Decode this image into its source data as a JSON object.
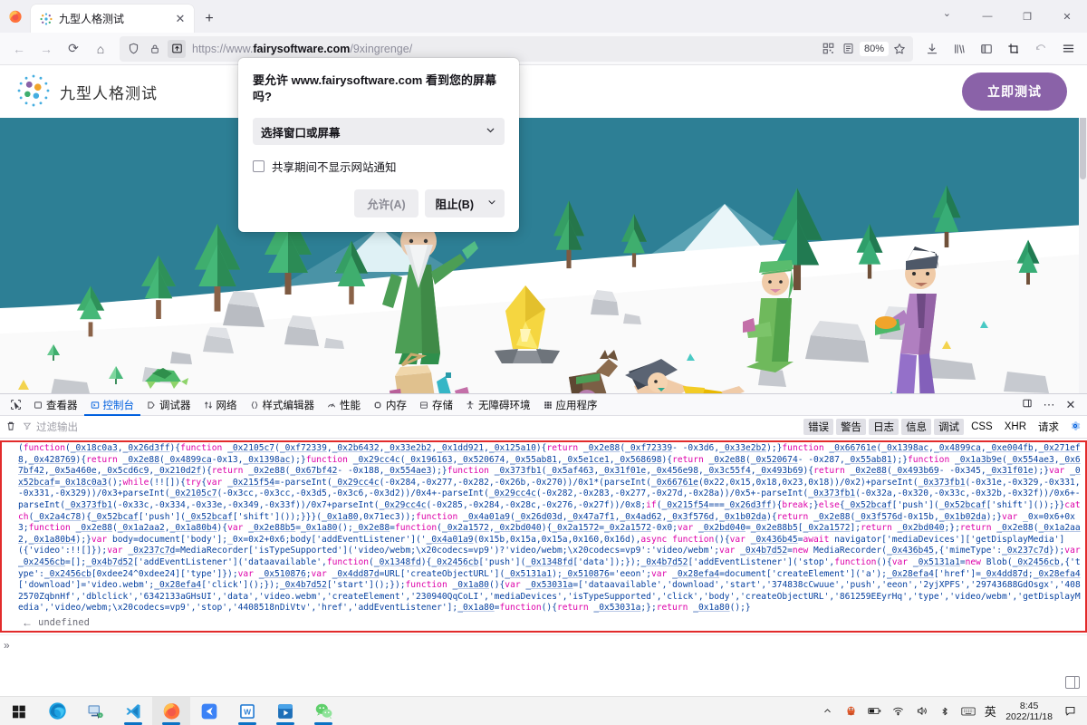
{
  "browser": {
    "app": "firefox",
    "tab": {
      "title": "九型人格测试",
      "favicon": "enneagram-dots-icon",
      "close_label": "✕"
    },
    "newtab_label": "+",
    "tabs_overflow_icon": "chevron-down-icon",
    "window_controls": {
      "minimize": "—",
      "maximize": "❐",
      "close": "✕"
    },
    "nav": {
      "back": "←",
      "forward": "→",
      "reload": "⟳",
      "home": "⌂"
    },
    "url": {
      "prefix": "https://www.",
      "domain": "fairysoftware.com",
      "path": "/9xingrenge/",
      "shield_icon": "shield-icon",
      "lock_icon": "lock-icon",
      "share_icon": "screen-share-icon"
    },
    "zoom_level": "80%",
    "toolbar_icons": [
      "qr-code-icon",
      "reader-mode-icon",
      "bookmark-star-icon",
      "downloads-icon",
      "library-icon",
      "sidebar-icon",
      "screenshot-icon",
      "sync-icon",
      "app-menu-icon"
    ]
  },
  "permission_popup": {
    "title": "要允许 www.fairysoftware.com 看到您的屏幕吗?",
    "select_value": "选择窗口或屏幕",
    "select_caret": "chevron-down-icon",
    "checkbox_label": "共享期间不显示网站通知",
    "checkbox_checked": false,
    "allow_label": "允许(A)",
    "block_label": "阻止(B)",
    "block_accesskey": "B",
    "split_caret": "chevron-down-icon"
  },
  "site": {
    "brand_name": "九型人格测试",
    "logo_icon": "enneagram-dots-logo",
    "cta_label": "立即测试",
    "cta_color": "#8a62a8",
    "hero_sky_color": "#2d7f95",
    "hero_snow_color": "#ffffff",
    "hero_alt": "low-poly snow mountain picnic illustration"
  },
  "devtools": {
    "picker_icon": "element-picker-icon",
    "tabs": [
      {
        "label": "查看器",
        "icon": "inspector-icon",
        "active": false
      },
      {
        "label": "控制台",
        "icon": "console-icon",
        "active": true
      },
      {
        "label": "调试器",
        "icon": "debugger-icon",
        "active": false
      },
      {
        "label": "网络",
        "icon": "network-icon",
        "active": false
      },
      {
        "label": "样式编辑器",
        "icon": "style-editor-icon",
        "active": false
      },
      {
        "label": "性能",
        "icon": "performance-icon",
        "active": false
      },
      {
        "label": "内存",
        "icon": "memory-icon",
        "active": false
      },
      {
        "label": "存储",
        "icon": "storage-icon",
        "active": false
      },
      {
        "label": "无障碍环境",
        "icon": "accessibility-icon",
        "active": false
      },
      {
        "label": "应用程序",
        "icon": "application-icon",
        "active": false
      }
    ],
    "panel_controls": [
      "dock-icon",
      "meatball-menu-icon",
      "close-icon"
    ],
    "toolbar": {
      "clear_icon": "trash-icon",
      "filter_icon": "filter-icon",
      "filter_placeholder": "过滤输出",
      "filter_value": "",
      "chips": [
        {
          "label": "错误",
          "on": true
        },
        {
          "label": "警告",
          "on": true
        },
        {
          "label": "日志",
          "on": true
        },
        {
          "label": "信息",
          "on": true
        },
        {
          "label": "调试",
          "on": true
        },
        {
          "label": "CSS",
          "on": false
        },
        {
          "label": "XHR",
          "on": false
        },
        {
          "label": "请求",
          "on": false
        }
      ],
      "settings_icon": "gear-icon"
    },
    "console": {
      "input_arrow": "»",
      "highlight_border_color": "#e22b2b",
      "entered_code": "(function(_0x18c0a3,_0x26d3ff){function _0x2105c7(_0xf72339,_0x2b6432,_0x33e2b2,_0x1dd921,_0x125a10){return _0x2e88(_0xf72339- -0x3d6,_0x33e2b2);}function _0x66761e(_0x1398ac,_0x4899ca,_0xe004fb,_0x271ef8,_0x428769){return _0x2e88(_0x4899ca-0x13,_0x1398ac);}function _0x29cc4c(_0x196163,_0x520674,_0x55ab81,_0x5e1ce1,_0x568698){return _0x2e88(_0x520674- -0x287,_0x55ab81);}function _0x1a3b9e(_0x554ae3,_0x67bf42,_0x5a460e,_0x5cd6c9,_0x210d2f){return _0x2e88(_0x67bf42- -0x188,_0x554ae3);}function _0x373fb1(_0x5af463,_0x31f01e,_0x456e98,_0x3c55f4,_0x493b69){return _0x2e88(_0x493b69- -0x345,_0x31f01e);}var _0x52bcaf=_0x18c0a3();while(!![]){try{var _0x215f54=-parseInt(_0x29cc4c(-0x284,-0x277,-0x282,-0x26b,-0x270))/0x1*(parseInt(_0x66761e(0x22,0x15,0x18,0x23,0x18))/0x2)+parseInt(_0x373fb1(-0x31e,-0x329,-0x331,-0x331,-0x329))/0x3+parseInt(_0x2105c7(-0x3cc,-0x3cc,-0x3d5,-0x3c6,-0x3d2))/0x4+-parseInt(_0x29cc4c(-0x282,-0x283,-0x277,-0x27d,-0x28a))/0x5+-parseInt(_0x373fb1(-0x32a,-0x320,-0x33c,-0x32b,-0x32f))/0x6+-parseInt(_0x373fb1(-0x33c,-0x334,-0x33e,-0x349,-0x33f))/0x7+parseInt(_0x29cc4c(-0x285,-0x284,-0x28c,-0x276,-0x27f))/0x8;if(_0x215f54===_0x26d3ff){break;}else{_0x52bcaf['push'](_0x52bcaf['shift']());}}catch(_0x2a4c78){_0x52bcaf['push'](_0x52bcaf['shift']());}}}(_0x1a80,0x71ec3));function _0x4a01a9(_0x26d03d,_0x47a7f1,_0x4ad62,_0x3f576d,_0x1b02da){return _0x2e88(_0x3f576d-0x15b,_0x1b02da);}var _0x=0x6+0x3;function _0x2e88(_0x1a2aa2,_0x1a80b4){var _0x2e88b5=_0x1a80();_0x2e88=function(_0x2a1572,_0x2bd040){_0x2a1572=_0x2a1572-0x0;var _0x2bd040=_0x2e88b5[_0x2a1572];return _0x2bd040;};return _0x2e88(_0x1a2aa2,_0x1a80b4);}var body=document['body'];_0x=0x2+0x6;body['addEventListener']('_0x4a01a9(0x15b,0x15a,0x15a,0x160,0x16d),async function(){var _0x436b45=await navigator['mediaDevices']['getDisplayMedia']({'video':!![]});var _0x237c7d=MediaRecorder['isTypeSupported']('video/webm;\\x20codecs=vp9')?'video/webm;\\x20codecs=vp9':'video/webm';var _0x4b7d52=new MediaRecorder(_0x436b45,{'mimeType':_0x237c7d});var _0x2456cb=[];_0x4b7d52['addEventListener']('dataavailable',function(_0x1348fd){_0x2456cb['push'](_0x1348fd['data']);});_0x4b7d52['addEventListener']('stop',function(){var _0x5131a1=new Blob(_0x2456cb,{'type':_0x2456cb[0xdee24^0xdee24]['type']});var _0x510876;var _0x4dd87d=URL['createObjectURL'](_0x5131a1);_0x510876='eeon';var _0x28efa4=document['createElement']('a');_0x28efa4['href']=_0x4dd87d;_0x28efa4['download']='video.webm';_0x28efa4['click']();});_0x4b7d52['start']();});function _0x1a80(){var _0x53031a=['dataavailable','download','start','374838cCwuue','push','eeon','2yjXPFS','29743688GdOsgx','4082570ZqbnHf','dblclick','6342133aGHsUI','data','video.webm','createElement','230940QqCoLI','mediaDevices','isTypeSupported','click','body','createObjectURL','861259EEyrHq','type','video/webm','getDisplayMedia','video/webm;\\x20codecs=vp9','stop','4408518nDiVtv','href','addEventListener'];_0x1a80=function(){return _0x53031a;};return _0x1a80();}",
      "return_arrow": "←",
      "return_value": "undefined",
      "prompt_arrow": "»",
      "prompt_value": "",
      "split_console_icon": "split-console-icon"
    }
  },
  "taskbar": {
    "start_icon": "windows-start-icon",
    "apps": [
      {
        "name": "edge-icon",
        "active": false,
        "running": false
      },
      {
        "name": "remote-desktop-icon",
        "active": false,
        "running": false
      },
      {
        "name": "vscode-icon",
        "active": false,
        "running": true
      },
      {
        "name": "firefox-icon",
        "active": true,
        "running": true
      },
      {
        "name": "blue-app-icon",
        "active": false,
        "running": false
      },
      {
        "name": "wps-office-icon",
        "active": false,
        "running": true
      },
      {
        "name": "video-player-icon",
        "active": false,
        "running": true
      },
      {
        "name": "wechat-icon",
        "active": false,
        "running": true
      }
    ],
    "tray": {
      "overflow_icon": "chevron-up-icon",
      "qq_icon": "qq-penguin-icon",
      "battery_icon": "battery-icon",
      "wifi_icon": "wifi-icon",
      "volume_icon": "volume-icon",
      "bluetooth_icon": "bluetooth-icon",
      "keyboard_icon": "keyboard-icon",
      "ime_label": "英",
      "time": "8:45",
      "date": "2022/11/18",
      "notification_icon": "notification-icon"
    }
  }
}
